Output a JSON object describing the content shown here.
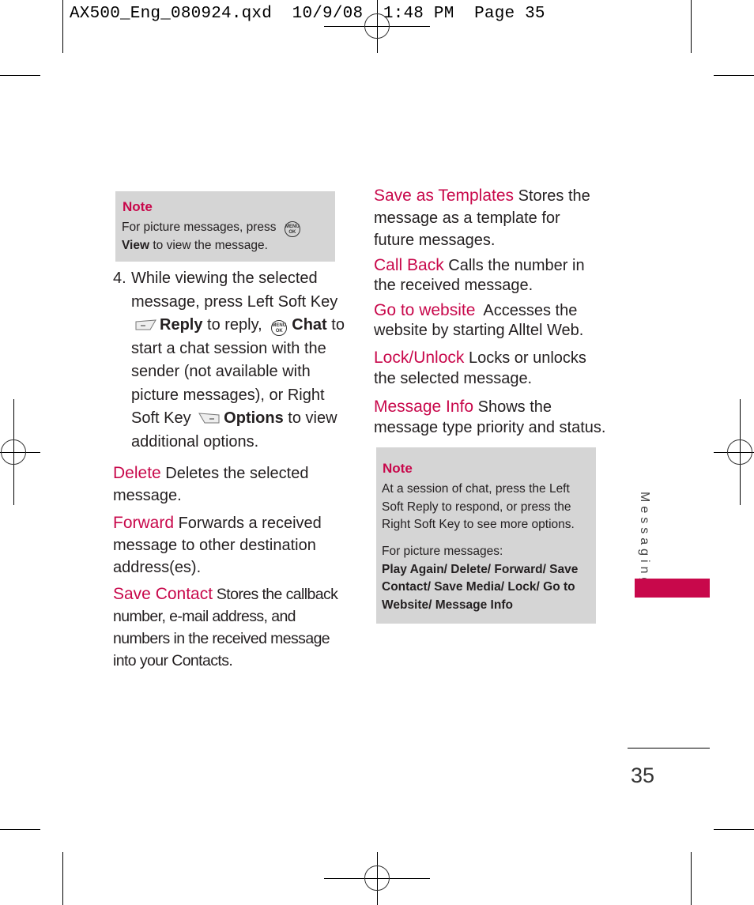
{
  "print_slug": {
    "filename": "AX500_Eng_080924.qxd",
    "date": "10/9/08",
    "time": "1:48 PM",
    "page_label": "Page 35"
  },
  "colors": {
    "accent": "#c8084b",
    "note_background": "#d5d5d5",
    "text": "#231f20"
  },
  "note_top": {
    "title": "Note",
    "line1": "For picture messages, press",
    "icon": "menu-ok-key-icon",
    "bold_word": "View",
    "line2_rest": " to view the message."
  },
  "step4": {
    "number": "4.",
    "text1": "While viewing the selected message, press Left Soft Key",
    "left_softkey_icon": "left-soft-key-icon",
    "reply_label": "Reply",
    "text2": " to reply,",
    "menu_ok_icon": "menu-ok-key-icon",
    "chat_label": "Chat",
    "text3": " to start a chat session with the sender (not available with picture messages), or Right Soft Key",
    "right_softkey_icon": "right-soft-key-icon",
    "options_label": "Options",
    "text4": " to view additional options."
  },
  "left_options": [
    {
      "term": "Delete",
      "description": " Deletes the selected message."
    },
    {
      "term": "Forward",
      "description": " Forwards a received message to other destination address(es)."
    },
    {
      "term": "Save Contact",
      "description": " Stores the callback number, e-mail address, and numbers in the received message into your Contacts."
    }
  ],
  "right_options": [
    {
      "term": "Save as Templates",
      "description": " Stores the message as a template for future messages."
    },
    {
      "term": "Call Back",
      "description": " Calls the number in the received message."
    },
    {
      "term": "Go to website",
      "description": "  Accesses the website by starting Alltel Web."
    },
    {
      "term": "Lock/Unlock",
      "description": " Locks or unlocks the selected message."
    },
    {
      "term": "Message Info",
      "description": " Shows the message type priority and status."
    }
  ],
  "note_bottom": {
    "title": "Note",
    "paragraph1": "At a session of chat, press the Left Soft Reply to respond, or press the Right Soft Key to see more options.",
    "paragraph2_intro": "For picture messages:",
    "paragraph2_bold": "Play Again/ Delete/ Forward/ Save Contact/ Save Media/ Lock/ Go to Website/ Message Info"
  },
  "side_tab": {
    "label": "Messaging"
  },
  "page_number": "35"
}
